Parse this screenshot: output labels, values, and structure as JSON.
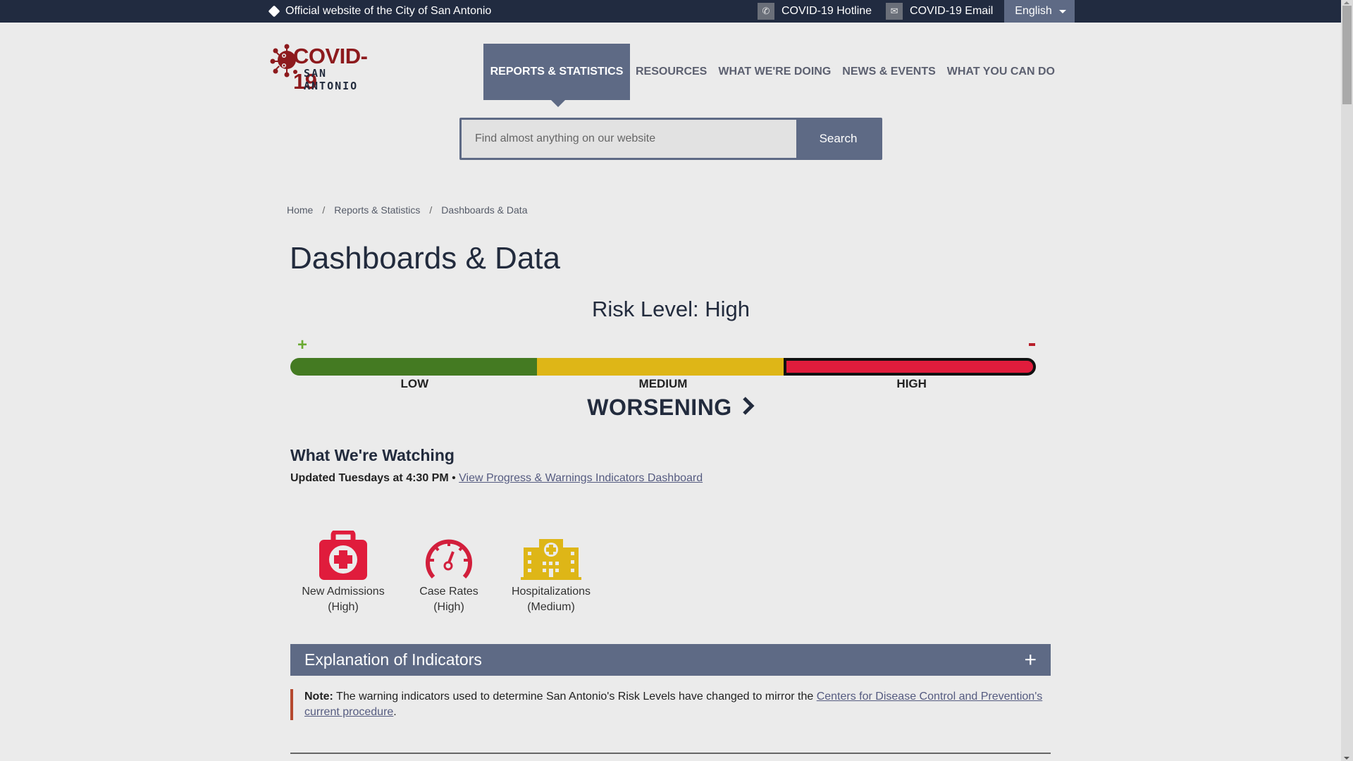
{
  "topbar": {
    "official_text": "Official website of the City of San Antonio",
    "hotline_label": "COVID-19 Hotline",
    "email_label": "COVID-19 Email",
    "language": "English"
  },
  "logo": {
    "line1": "COVID-19",
    "line2": "SAN ANTONIO"
  },
  "nav": {
    "items": [
      {
        "label": "REPORTS & STATISTICS",
        "active": true
      },
      {
        "label": "RESOURCES"
      },
      {
        "label": "WHAT WE'RE DOING"
      },
      {
        "label": "NEWS & EVENTS"
      },
      {
        "label": "WHAT YOU CAN DO"
      }
    ]
  },
  "search": {
    "placeholder": "Find almost anything on our website",
    "value": "",
    "button_label": "Search"
  },
  "breadcrumb": {
    "items": [
      "Home",
      "Reports & Statistics",
      "Dashboards & Data"
    ],
    "separator": "/"
  },
  "page": {
    "title": "Dashboards & Data"
  },
  "risk": {
    "title": "Risk Level: High",
    "current_level": "HIGH",
    "better_symbol": "+",
    "worse_symbol": "-",
    "levels": [
      "LOW",
      "MEDIUM",
      "HIGH"
    ],
    "colors": {
      "low": "#447a22",
      "medium": "#deb617",
      "high": "#e01c3c"
    },
    "trend": "WORSENING",
    "trend_icon": "chevron-right-icon"
  },
  "watching": {
    "title": "What We're Watching",
    "updated": "Updated Tuesdays at 4:30 PM",
    "bullet": "•",
    "link_label": "View Progress & Warnings Indicators Dashboard"
  },
  "indicators": [
    {
      "icon": "first-aid-kit-icon",
      "name": "New Admissions",
      "level": "(High)",
      "color": "#e01c3c"
    },
    {
      "icon": "speedometer-icon",
      "name": "Case Rates",
      "level": "(High)",
      "color": "#d21f3c"
    },
    {
      "icon": "hospital-icon",
      "name": "Hospitalizations",
      "level": "(Medium)",
      "color": "#deb617"
    }
  ],
  "accordion": {
    "title": "Explanation of Indicators",
    "toggle": "+"
  },
  "note": {
    "label": "Note:",
    "text": " The warning indicators used to determine San Antonio's Risk Levels have changed to mirror the ",
    "link_label": "Centers for Disease Control and Prevention's current procedure",
    "trailing": "."
  }
}
